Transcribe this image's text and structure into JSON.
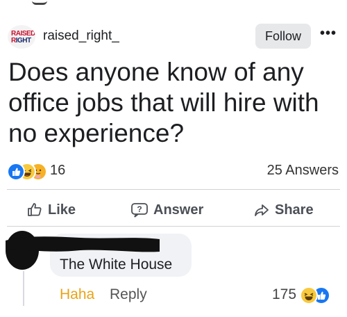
{
  "header": {
    "logo_line1": "RAISED",
    "logo_line2_a": "R",
    "logo_line2_b": "IGHT",
    "username": "raised_right_",
    "follow_label": "Follow",
    "more_label": "•••"
  },
  "post": {
    "question": "Does anyone know of any office jobs that will hire with no experience?",
    "reaction_count": "16",
    "reaction_icons": [
      "like-icon",
      "haha-icon",
      "care-icon"
    ],
    "answers_label": "25 Answers"
  },
  "actions": {
    "like_label": "Like",
    "answer_label": "Answer",
    "share_label": "Share"
  },
  "comment": {
    "text": "The White House",
    "haha_label": "Haha",
    "reply_label": "Reply",
    "reaction_count": "175",
    "reaction_icons": [
      "haha-icon",
      "like-icon"
    ]
  },
  "colors": {
    "like_blue": "#1877f2",
    "haha_yellow": "#f7c93e",
    "haha_link": "#e8a317",
    "button_gray": "#e7e8ea",
    "bubble_gray": "#f0f2f5"
  }
}
